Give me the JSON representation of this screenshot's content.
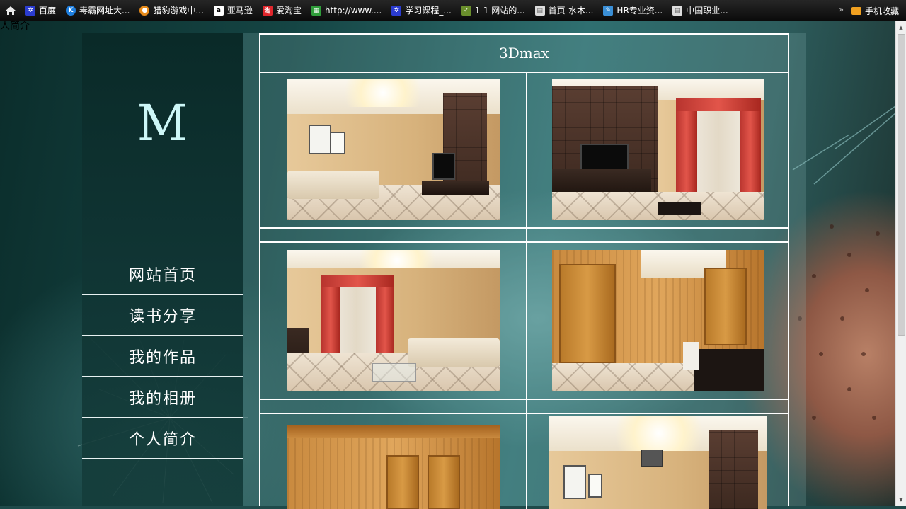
{
  "bookmarks": {
    "home_icon": "home-icon",
    "items": [
      {
        "label": "百度",
        "icon": "baidu-icon",
        "color": "#2b3cd0"
      },
      {
        "label": "毒霸网址大...",
        "icon": "duba-icon",
        "color": "#1e7fe0"
      },
      {
        "label": "猎豹游戏中...",
        "icon": "liebao-icon",
        "color": "#e88b1a"
      },
      {
        "label": "亚马逊",
        "icon": "amazon-icon",
        "color": "#ffffff"
      },
      {
        "label": "爱淘宝",
        "icon": "taobao-icon",
        "color": "#e0262c"
      },
      {
        "label": "http://www....",
        "icon": "qr-icon",
        "color": "#2f9d3a"
      },
      {
        "label": "学习课程_...",
        "icon": "baidu-icon",
        "color": "#2b3cd0"
      },
      {
        "label": "1-1 网站的...",
        "icon": "imooc-icon",
        "color": "#6a8f2c"
      },
      {
        "label": "首页-水木...",
        "icon": "page-icon",
        "color": "#dddddd"
      },
      {
        "label": "HR专业资...",
        "icon": "hr-icon",
        "color": "#3a8fd6"
      },
      {
        "label": "中国职业...",
        "icon": "page-icon",
        "color": "#dddddd"
      }
    ],
    "more": "»",
    "mobile_label": "手机收藏"
  },
  "page": {
    "stray_text": "人简介",
    "logo": "M",
    "nav": [
      "网站首页",
      "读书分享",
      "我的作品",
      "我的相册",
      "个人简介"
    ],
    "section_title": "3Dmax"
  },
  "colors": {
    "accent_logo": "#cdf7f7",
    "curtain_red": "#d4483e"
  }
}
